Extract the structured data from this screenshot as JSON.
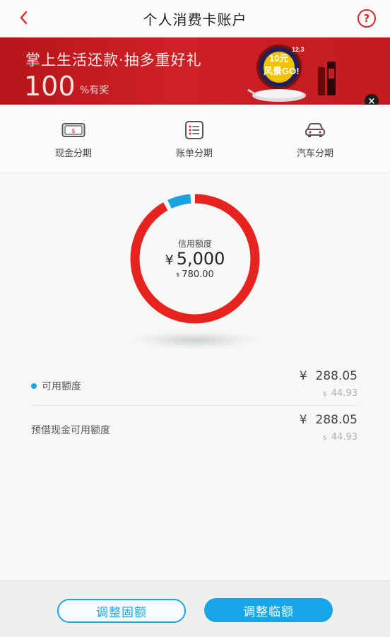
{
  "header": {
    "title": "个人消费卡账户",
    "help_label": "?"
  },
  "banner": {
    "title": "掌上生活还款·抽多重好礼",
    "big_number": "100",
    "suffix": "%有奖",
    "promo_line1": "10元",
    "promo_line2": "风景GO!",
    "promo_date": "12.3",
    "close_label": "×"
  },
  "menu": {
    "items": [
      {
        "label": "现金分期",
        "icon": "cash-card-icon"
      },
      {
        "label": "账单分期",
        "icon": "bill-list-icon"
      },
      {
        "label": "汽车分期",
        "icon": "car-icon"
      }
    ]
  },
  "credit": {
    "label": "信用额度",
    "currency": "¥",
    "amount": "5,000",
    "usd_symbol": "$",
    "usd_amount": "780.00",
    "used_fraction": 0.058,
    "ring_color": "#e6231f",
    "used_color": "#16a5e0"
  },
  "available": {
    "label": "可用额度",
    "currency": "¥",
    "amount": "288.05",
    "usd_symbol": "$",
    "usd_amount": "44.93"
  },
  "cash_available": {
    "label": "预借现金可用额度",
    "currency": "¥",
    "amount": "288.05",
    "usd_symbol": "$",
    "usd_amount": "44.93"
  },
  "buttons": {
    "adjust_fixed": "调整固额",
    "adjust_temp": "调整临额"
  },
  "colors": {
    "accent": "#d7262b",
    "blue": "#16a5e6"
  }
}
